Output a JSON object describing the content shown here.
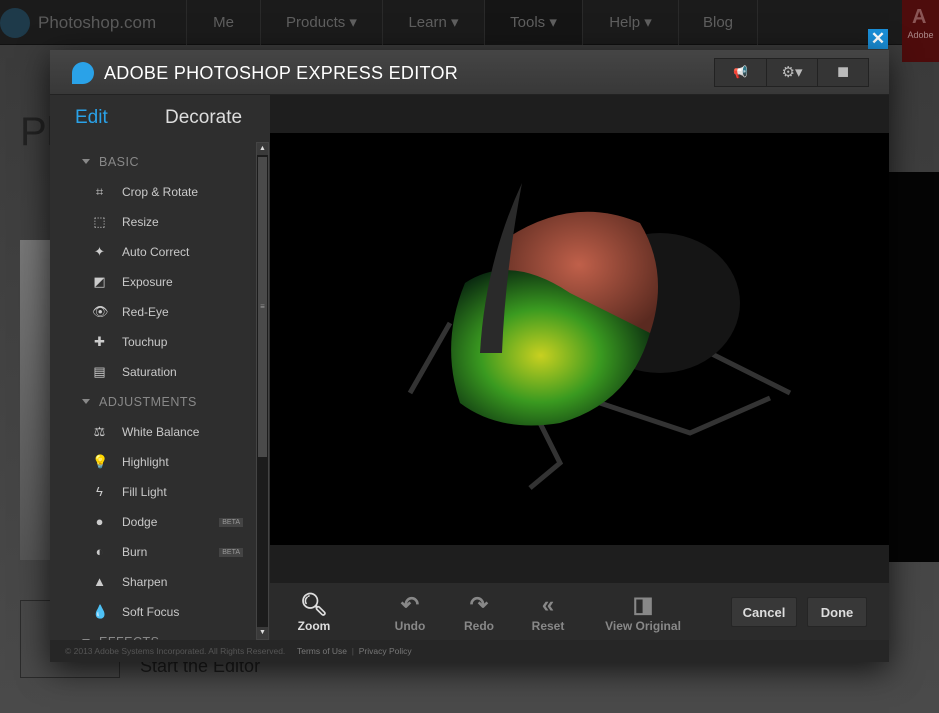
{
  "site": {
    "brand": "Photoshop.com",
    "nav": [
      "Me",
      "Products ▾",
      "Learn ▾",
      "Tools ▾",
      "Help ▾",
      "Blog"
    ],
    "adobe": "Adobe",
    "bg_heading": "Ph",
    "bg_link": "Start the Editor"
  },
  "modal": {
    "title": "ADOBE PHOTOSHOP EXPRESS EDITOR",
    "close": "✕",
    "header_buttons": [
      {
        "icon": "megaphone-icon",
        "glyph": "📢"
      },
      {
        "icon": "gear-icon",
        "glyph": "⚙▾"
      },
      {
        "icon": "fullscreen-icon",
        "glyph": "■"
      }
    ],
    "tabs": {
      "edit": "Edit",
      "decorate": "Decorate",
      "active": "Edit"
    },
    "sections": [
      {
        "label": "BASIC",
        "items": [
          {
            "label": "Crop & Rotate",
            "icon": "crop-icon",
            "glyph": "⌗"
          },
          {
            "label": "Resize",
            "icon": "resize-icon",
            "glyph": "⬚"
          },
          {
            "label": "Auto Correct",
            "icon": "magic-wand-icon",
            "glyph": "✦"
          },
          {
            "label": "Exposure",
            "icon": "exposure-icon",
            "glyph": "◩"
          },
          {
            "label": "Red-Eye",
            "icon": "eye-icon",
            "glyph": "👁"
          },
          {
            "label": "Touchup",
            "icon": "bandage-icon",
            "glyph": "✚"
          },
          {
            "label": "Saturation",
            "icon": "saturation-icon",
            "glyph": "▤"
          }
        ]
      },
      {
        "label": "ADJUSTMENTS",
        "items": [
          {
            "label": "White Balance",
            "icon": "scales-icon",
            "glyph": "⚖"
          },
          {
            "label": "Highlight",
            "icon": "bulb-icon",
            "glyph": "💡"
          },
          {
            "label": "Fill Light",
            "icon": "bolt-icon",
            "glyph": "ϟ"
          },
          {
            "label": "Dodge",
            "icon": "dodge-icon",
            "glyph": "●",
            "badge": "BETA"
          },
          {
            "label": "Burn",
            "icon": "burn-icon",
            "glyph": "◐",
            "badge": "BETA"
          },
          {
            "label": "Sharpen",
            "icon": "sharpen-icon",
            "glyph": "▲"
          },
          {
            "label": "Soft Focus",
            "icon": "drop-icon",
            "glyph": "💧"
          }
        ]
      },
      {
        "label": "EFFECTS",
        "items": []
      }
    ],
    "toolbar": {
      "zoom": "Zoom",
      "undo": "Undo",
      "redo": "Redo",
      "reset": "Reset",
      "view_original": "View Original",
      "cancel": "Cancel",
      "done": "Done"
    },
    "footer": {
      "copyright": "© 2013 Adobe Systems Incorporated. All Rights Reserved.",
      "terms": "Terms of Use",
      "sep": "|",
      "privacy": "Privacy Policy"
    }
  },
  "colors": {
    "accent": "#2aa2e8",
    "close": "#1a8fd9"
  }
}
